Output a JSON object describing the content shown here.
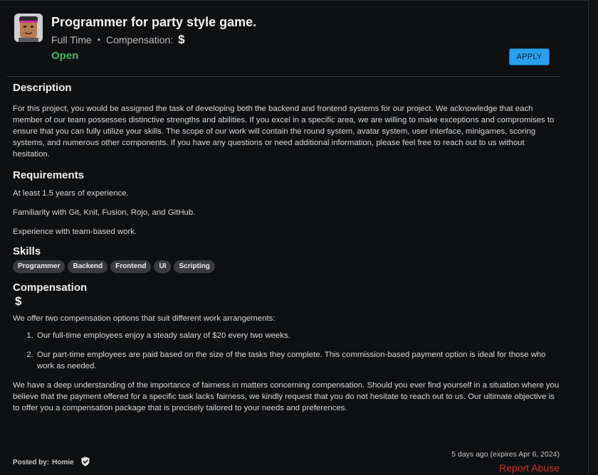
{
  "job": {
    "title": "Programmer for party style game.",
    "type": "Full Time",
    "separator": "•",
    "compensation_label": "Compensation:",
    "compensation_icon": "$",
    "status": "Open",
    "apply_label": "APPLY"
  },
  "description": {
    "heading": "Description",
    "text": "For this project, you would be assigned the task of developing both the backend and frontend systems for our project. We acknowledge that each member of our team possesses distinctive strengths and abilities. If you excel in a specific area, we are willing to make exceptions and compromises to ensure that you can fully utilize your skills. The scope of our work will contain the round system, avatar system, user interface, minigames, scoring systems, and numerous other components. If you have any questions or need additional information, please feel free to reach out to us without hesitation."
  },
  "requirements": {
    "heading": "Requirements",
    "items": [
      "At least 1.5 years of experience.",
      "Familiarity with Git, Knit, Fusion, Rojo, and GitHub.",
      "Experience with team-based work."
    ]
  },
  "skills": {
    "heading": "Skills",
    "tags": [
      "Programmer",
      "Backend",
      "Frontend",
      "UI",
      "Scripting"
    ]
  },
  "compensation": {
    "heading": "Compensation",
    "icon": "$",
    "intro": "We offer two compensation options that suit different work arrangements:",
    "options": [
      "Our full-time employees enjoy a steady salary of $20 every two weeks.",
      "Our part-time employees are paid based on the size of the tasks they complete. This commission-based payment option is ideal for those who work as needed."
    ],
    "closing": "We have a deep understanding of the importance of fairness in matters concerning compensation. Should you ever find yourself in a situation where you believe that the payment offered for a specific task lacks fairness, we kindly request that you do not hesitate to reach out to us. Our ultimate objective is to offer you a compensation package that is precisely tailored to your needs and preferences."
  },
  "footer": {
    "posted_label": "Posted by:",
    "poster": "Homie",
    "verified_icon": "shield-check-icon",
    "age": "5 days ago (expires Apr 6, 2024)",
    "report_label": "Report Abuse"
  },
  "colors": {
    "background": "#0f1012",
    "status_open": "#3ab85a",
    "apply_button": "#2aa0ea",
    "chip_bg": "#3a3b3f",
    "report": "#d2322d"
  }
}
